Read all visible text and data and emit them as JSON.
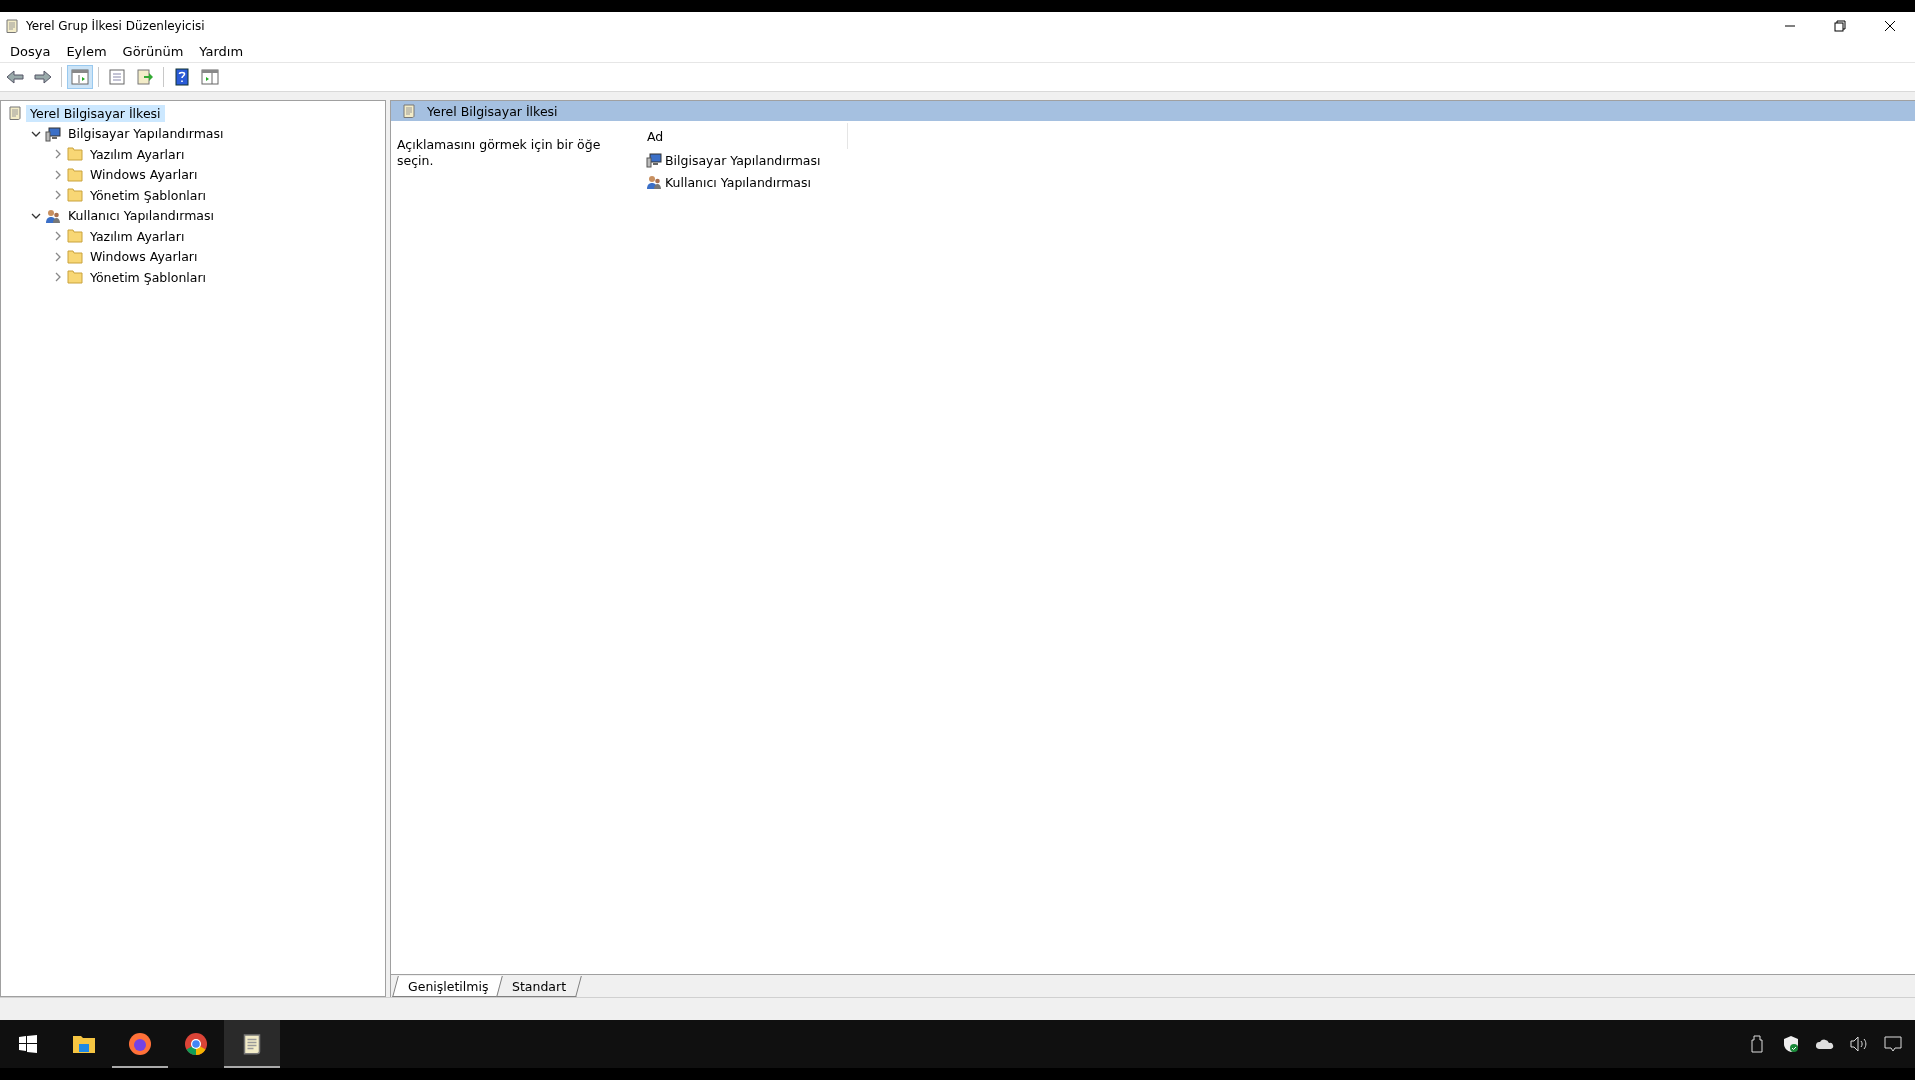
{
  "window": {
    "title": "Yerel Grup İlkesi Düzenleyicisi"
  },
  "menu": [
    "Dosya",
    "Eylem",
    "Görünüm",
    "Yardım"
  ],
  "toolbar": [
    {
      "kind": "back",
      "selected": false
    },
    {
      "kind": "forward",
      "selected": false
    },
    {
      "kind": "sep"
    },
    {
      "kind": "tree",
      "selected": true
    },
    {
      "kind": "sep"
    },
    {
      "kind": "properties",
      "selected": false
    },
    {
      "kind": "export",
      "selected": false
    },
    {
      "kind": "sep"
    },
    {
      "kind": "help",
      "selected": false
    },
    {
      "kind": "pane",
      "selected": false
    }
  ],
  "tree": {
    "label": "Yerel Bilgisayar İlkesi",
    "kind": "policy",
    "selected": true,
    "children": [
      {
        "label": "Bilgisayar Yapılandırması",
        "kind": "computer",
        "expanded": true,
        "selected": false,
        "children": [
          {
            "label": "Yazılım Ayarları",
            "kind": "folder",
            "expanded": false,
            "selected": false
          },
          {
            "label": "Windows Ayarları",
            "kind": "folder",
            "expanded": false,
            "selected": false
          },
          {
            "label": "Yönetim Şablonları",
            "kind": "folder",
            "expanded": false,
            "selected": false
          }
        ]
      },
      {
        "label": "Kullanıcı Yapılandırması",
        "kind": "user",
        "expanded": true,
        "selected": false,
        "children": [
          {
            "label": "Yazılım Ayarları",
            "kind": "folder",
            "expanded": false,
            "selected": false
          },
          {
            "label": "Windows Ayarları",
            "kind": "folder",
            "expanded": false,
            "selected": false
          },
          {
            "label": "Yönetim Şablonları",
            "kind": "folder",
            "expanded": false,
            "selected": false
          }
        ]
      }
    ]
  },
  "details": {
    "header": "Yerel Bilgisayar İlkesi",
    "description": "Açıklamasını görmek için bir öğe seçin.",
    "column": "Ad",
    "items": [
      {
        "label": "Bilgisayar Yapılandırması",
        "kind": "computer"
      },
      {
        "label": "Kullanıcı Yapılandırması",
        "kind": "user"
      }
    ]
  },
  "view_tabs": [
    {
      "label": "Genişletilmiş",
      "selected": true
    },
    {
      "label": "Standart",
      "selected": false
    }
  ],
  "taskbar": {
    "apps": [
      {
        "kind": "explorer",
        "running": false,
        "selected": false
      },
      {
        "kind": "firefox",
        "running": true,
        "selected": false
      },
      {
        "kind": "chrome",
        "running": false,
        "selected": false
      },
      {
        "kind": "policy",
        "running": true,
        "selected": true
      }
    ],
    "tray": [
      {
        "kind": "usb"
      },
      {
        "kind": "security"
      },
      {
        "kind": "cloud"
      },
      {
        "kind": "volume"
      }
    ]
  }
}
